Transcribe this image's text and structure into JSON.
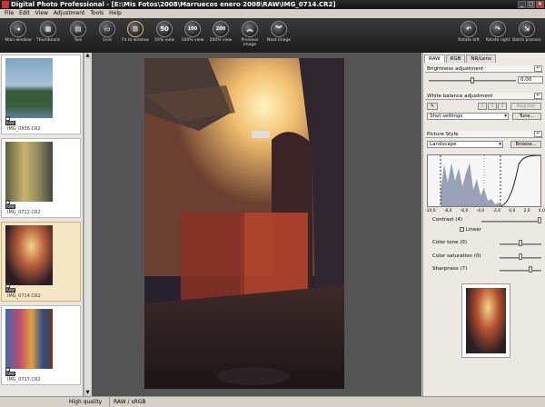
{
  "window": {
    "title": "Digital Photo Professional - [E:\\Mis Fotos\\2008\\Marruecos enero 2008\\RAW\\IMG_0714.CR2]"
  },
  "menu": [
    "File",
    "Edit",
    "View",
    "Adjustment",
    "Tools",
    "Help"
  ],
  "toolbar": {
    "main_window": "Main window",
    "thumbnails": "Thumbnails",
    "tool": "Tool",
    "grid": "Grid",
    "fit": "Fit to window",
    "v50": "50",
    "v50_label": "50% view",
    "v100": "100",
    "v100_label": "100% view",
    "v200": "200",
    "v200_label": "200% view",
    "prev": "Previous image",
    "next": "Next image",
    "rot_left": "Rotate left",
    "rot_right": "Rotate right",
    "batch": "Batch process"
  },
  "thumbs": [
    {
      "name": "IMG_0836.CR2"
    },
    {
      "name": "IMG_0712.CR2"
    },
    {
      "name": "IMG_0714.CR2"
    },
    {
      "name": "IMG_0717.CR2"
    }
  ],
  "raw_badge": "RAW",
  "panel": {
    "tabs": [
      "RAW",
      "RGB",
      "NR/Lens"
    ],
    "brightness": {
      "title": "Brightness adjustment",
      "value": "0,00",
      "value_fraction": 0.5
    },
    "wb": {
      "title": "White balance adjustment",
      "nums": [
        "1",
        "2",
        "3"
      ],
      "register": "Register",
      "select": "Shot settings",
      "tune": "Tune..."
    },
    "ps": {
      "title": "Picture Style",
      "select": "Landscape",
      "browse": "Browse...",
      "ticks": [
        "-10,0",
        "-8,0",
        "-6,0",
        "-4,0",
        "-2,0",
        "0,0",
        "2,0",
        "4,0"
      ],
      "contrast": "Contrast (4)",
      "linear": "Linear",
      "color_tone": "Color tone (0)",
      "color_sat": "Color saturation (0)",
      "sharpness": "Sharpness (7)"
    }
  },
  "status": {
    "quality": "High quality",
    "color": "RAW / sRGB"
  },
  "reset_glyph": "↩"
}
